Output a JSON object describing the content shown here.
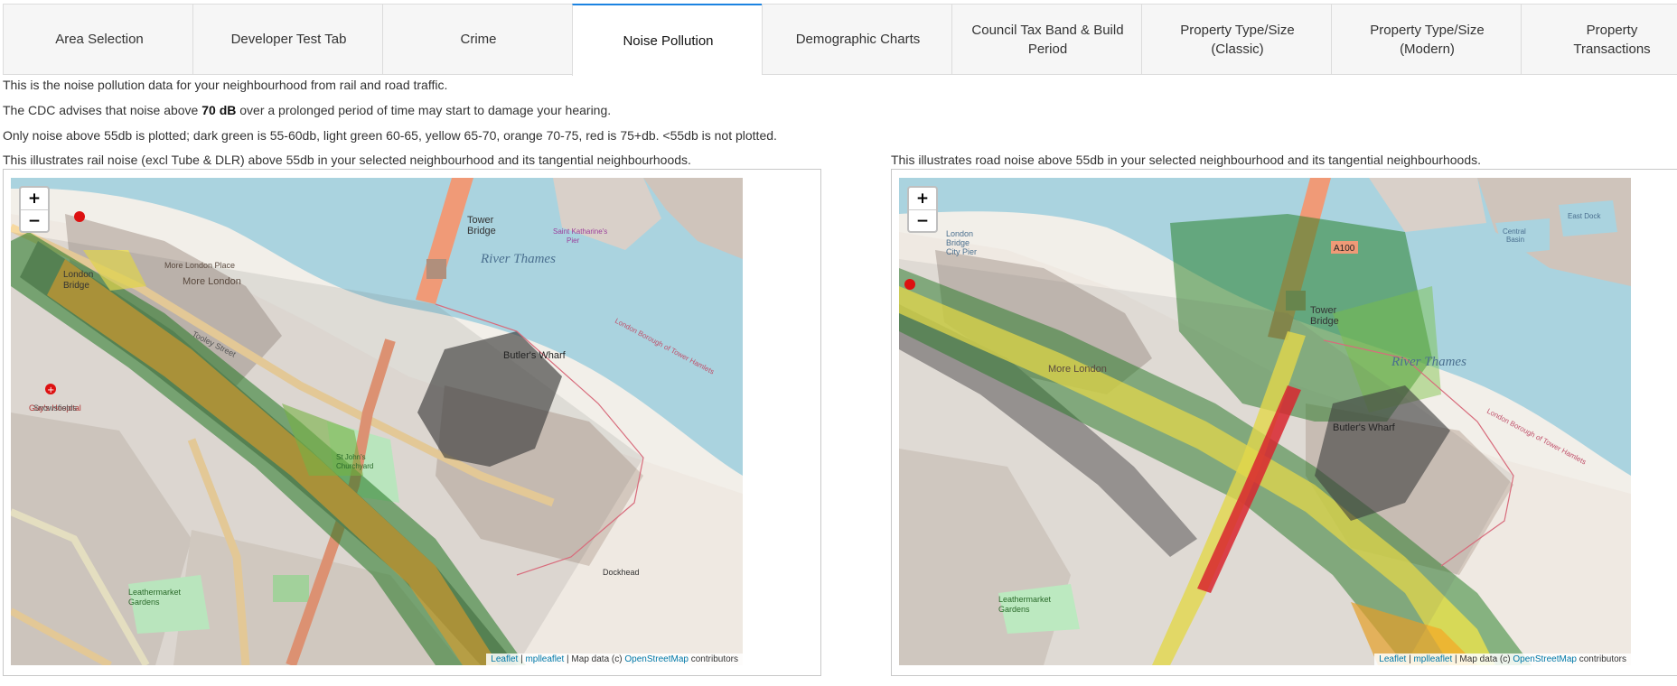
{
  "tabs": [
    {
      "label": "Area Selection",
      "active": false
    },
    {
      "label": "Developer Test Tab",
      "active": false
    },
    {
      "label": "Crime",
      "active": false
    },
    {
      "label": "Noise Pollution",
      "active": true
    },
    {
      "label": "Demographic Charts",
      "active": false
    },
    {
      "label": "Council Tax Band & Build\nPeriod",
      "active": false
    },
    {
      "label": "Property Type/Size\n(Classic)",
      "active": false
    },
    {
      "label": "Property Type/Size\n(Modern)",
      "active": false
    },
    {
      "label": "Property Transactions",
      "active": false
    }
  ],
  "intro": {
    "line1": "This is the noise pollution data for your neighbourhood from rail and road traffic.",
    "line2_prefix": "The CDC advises that noise above ",
    "line2_bold": "70 dB",
    "line2_suffix": " over a prolonged period of time may start to damage your hearing.",
    "line3": "Only noise above 55db is plotted; dark green is 55-60db, light green 60-65, yellow 65-70, orange 70-75, red is 75+db. <55db is not plotted."
  },
  "rail_map": {
    "caption": "This illustrates rail noise (excl Tube & DLR) above 55db in your selected neighbourhood and its tangential neighbourhoods.",
    "labels": {
      "river": "River Thames",
      "bridge": "Tower\nBridge",
      "london_bridge": "London\nBridge",
      "more_london": "More London",
      "more_london_place": "More London Place",
      "guys": "Guy's Hospital",
      "tooley": "Tooley Street",
      "butlers": "Butler's Wharf",
      "stjohns": "St John's\nChurchyard",
      "snowsfields": "Snowsfields",
      "leathermarket": "Leathermarket\nGardens",
      "borough": "London Borough of Tower Hamlets",
      "dockhead": "Dockhead",
      "pier": "Saint Katharine's\nPier"
    }
  },
  "road_map": {
    "caption": "This illustrates road noise above 55db in your selected neighbourhood and its tangential neighbourhoods.",
    "labels": {
      "river": "River Thames",
      "bridge": "Tower\nBridge",
      "london_bridge": "London\nBridge\nCity Pier",
      "more_london": "More London",
      "butlers": "Butler's Wharf",
      "leathermarket": "Leathermarket\nGardens",
      "a100": "A100",
      "central_basin": "Central\nBasin",
      "east_dock": "East Dock",
      "borough": "London Borough of Tower Hamlets"
    }
  },
  "zoom": {
    "in": "+",
    "out": "−"
  },
  "attribution": {
    "leaflet": "Leaflet",
    "sep1": " | ",
    "mplleaflet": "mplleaflet",
    "sep2": " | Map data (c) ",
    "osm": "OpenStreetMap",
    "contrib": " contributors"
  },
  "colors": {
    "water": "#aad3df",
    "land": "#f2efe9",
    "building": "#c8b9ad",
    "park": "#c8facc",
    "noise_55_60": "#1e7b1e",
    "noise_60_65": "#7bc043",
    "noise_65_70": "#f2e64a",
    "noise_70_75": "#f5a623",
    "noise_75_plus": "#e8202a",
    "overlay": "#3a3a3a",
    "accent": "#1c83e1"
  }
}
